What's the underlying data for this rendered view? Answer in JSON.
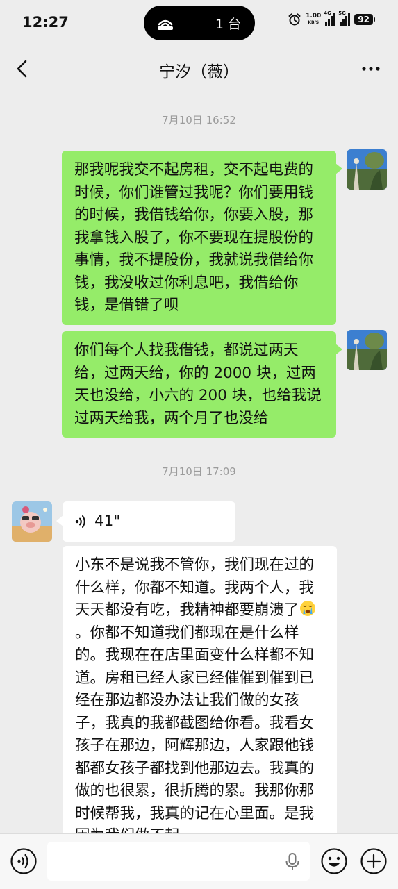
{
  "status_bar": {
    "time": "12:27",
    "cast_count": "1 台",
    "net_speed_value": "1.00",
    "net_speed_unit": "KB/S",
    "network_1": "4G",
    "network_2": "5G",
    "battery": "92"
  },
  "nav": {
    "title": "宁汐（薇）",
    "back_icon": "chevron-left-icon",
    "more_icon": "more-dots-icon"
  },
  "messages": [
    {
      "type": "timestamp",
      "text": "7月10日 16:52"
    },
    {
      "type": "text",
      "direction": "outgoing",
      "text": "那我呢我交不起房租，交不起电费的时候，你们谁管过我呢？你们要用钱的时候，我借钱给你，你要入股，那我拿钱入股了，你不要现在提股份的事情，我不提股份，我就说我借给你钱，我没收过你利息吧，我借给你钱，是借错了呗"
    },
    {
      "type": "text",
      "direction": "outgoing",
      "text": "你们每个人找我借钱，都说过两天给，过两天给，你的 2000 块，过两天也没给，小六的 200 块，也给我说过两天给我，两个月了也没给"
    },
    {
      "type": "timestamp",
      "text": "7月10日 17:09"
    },
    {
      "type": "voice",
      "direction": "incoming",
      "duration": "41\""
    },
    {
      "type": "text",
      "direction": "incoming",
      "text_before_emoji": "小东不是说我不管你，我们现在过的什么样，你都不知道。我两个人，我天天都没有吃，我精神都要崩溃了",
      "emoji": "crying-face-emoji",
      "text_after_emoji": "。你都不知道我们都现在是什么样的。我现在在店里面变什么样都不知道。房租已经人家已经催催到催到已经在那边都没办法让我们做的女孩子，我真的我都截图给你看。我看女孩子在那边，阿辉那边，人家跟他钱都都女孩子都找到他那边去。我真的做的也很累，很折腾的累。我那你那时候帮我，我真的记在心里面。是我因为我们做不起"
    }
  ],
  "input_bar": {
    "value": "",
    "voice_icon": "voice-mode-icon",
    "mic_icon": "mic-icon",
    "emoji_icon": "emoji-icon",
    "plus_icon": "plus-icon"
  },
  "colors": {
    "background": "#ededed",
    "outgoing_bubble": "#95ec69",
    "incoming_bubble": "#ffffff",
    "timestamp_text": "#9b9b9b"
  }
}
